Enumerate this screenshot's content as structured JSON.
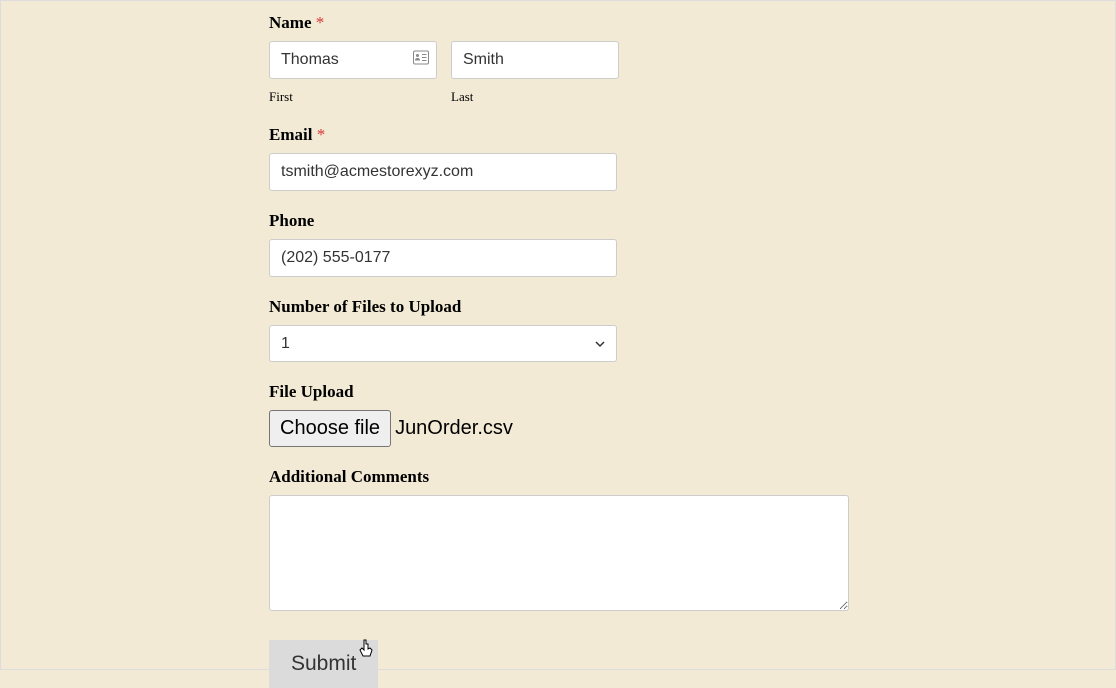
{
  "form": {
    "name": {
      "label": "Name",
      "required": "*",
      "first": {
        "value": "Thomas",
        "sublabel": "First"
      },
      "last": {
        "value": "Smith",
        "sublabel": "Last"
      }
    },
    "email": {
      "label": "Email",
      "required": "*",
      "value": "tsmith@acmestorexyz.com"
    },
    "phone": {
      "label": "Phone",
      "value": "(202) 555-0177"
    },
    "numFiles": {
      "label": "Number of Files to Upload",
      "selected": "1"
    },
    "fileUpload": {
      "label": "File Upload",
      "buttonLabel": "Choose file",
      "fileName": "JunOrder.csv"
    },
    "comments": {
      "label": "Additional Comments",
      "value": ""
    },
    "submit": {
      "label": "Submit"
    }
  }
}
